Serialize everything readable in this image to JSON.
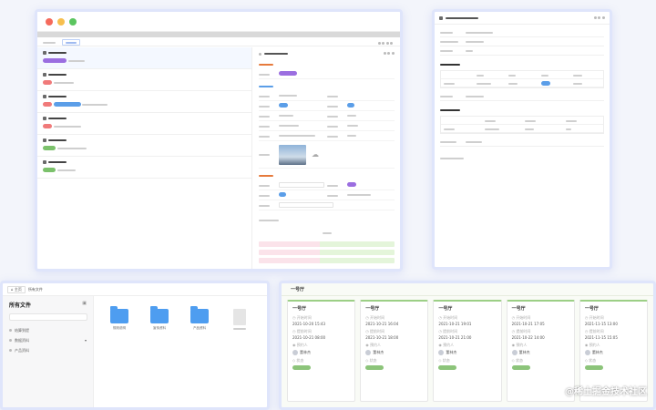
{
  "watermark": "@稀土掘金技术社区",
  "file_manager": {
    "breadcrumb": [
      "主页",
      "所有文件"
    ],
    "title": "所有文件",
    "sidebar": [
      "结算到提",
      "数据资料",
      "产品资料"
    ],
    "files": [
      {
        "name": "规则说明",
        "type": "folder"
      },
      {
        "name": "宣传资料",
        "type": "folder"
      },
      {
        "name": "产品资料",
        "type": "folder"
      }
    ]
  },
  "cards_panel": {
    "cards": [
      {
        "title": "一号厅",
        "start_label": "开始时间",
        "start": "2021-10-20 15:43",
        "submit_label": "提前时间",
        "submit": "2021-10-21 08:00",
        "person_label": "预约人",
        "person": "董林杰",
        "status_label": "状态"
      },
      {
        "title": "一号厅",
        "start_label": "开始时间",
        "start": "2021-10-21 16:04",
        "submit_label": "提前时间",
        "submit": "2021-10-21 18:00",
        "person_label": "预约人",
        "person": "董林杰",
        "status_label": "状态"
      },
      {
        "title": "一号厅",
        "start_label": "开始时间",
        "start": "2021-10-21 19:01",
        "submit_label": "提前时间",
        "submit": "2021-10-21 21:00",
        "person_label": "预约人",
        "person": "董林杰",
        "status_label": "状态"
      },
      {
        "title": "一号厅",
        "start_label": "开始时间",
        "start": "2021-10-21 17:05",
        "submit_label": "提前时间",
        "submit": "2021-10-22 14:00",
        "person_label": "预约人",
        "person": "董林杰",
        "status_label": "状态"
      },
      {
        "title": "一号厅",
        "start_label": "开始时间",
        "start": "2021-11-15 13:00",
        "submit_label": "提前时间",
        "submit": "2021-11-15 15:05",
        "person_label": "预约人",
        "person": "董林杰",
        "status_label": "状态"
      }
    ]
  },
  "colors": {
    "traffic_red": "#f56a5c",
    "traffic_yellow": "#f7bf4f",
    "traffic_green": "#5bc55f",
    "folder": "#4e9df0",
    "accent_green": "#8cc47a",
    "section_orange": "#e67a3c"
  }
}
